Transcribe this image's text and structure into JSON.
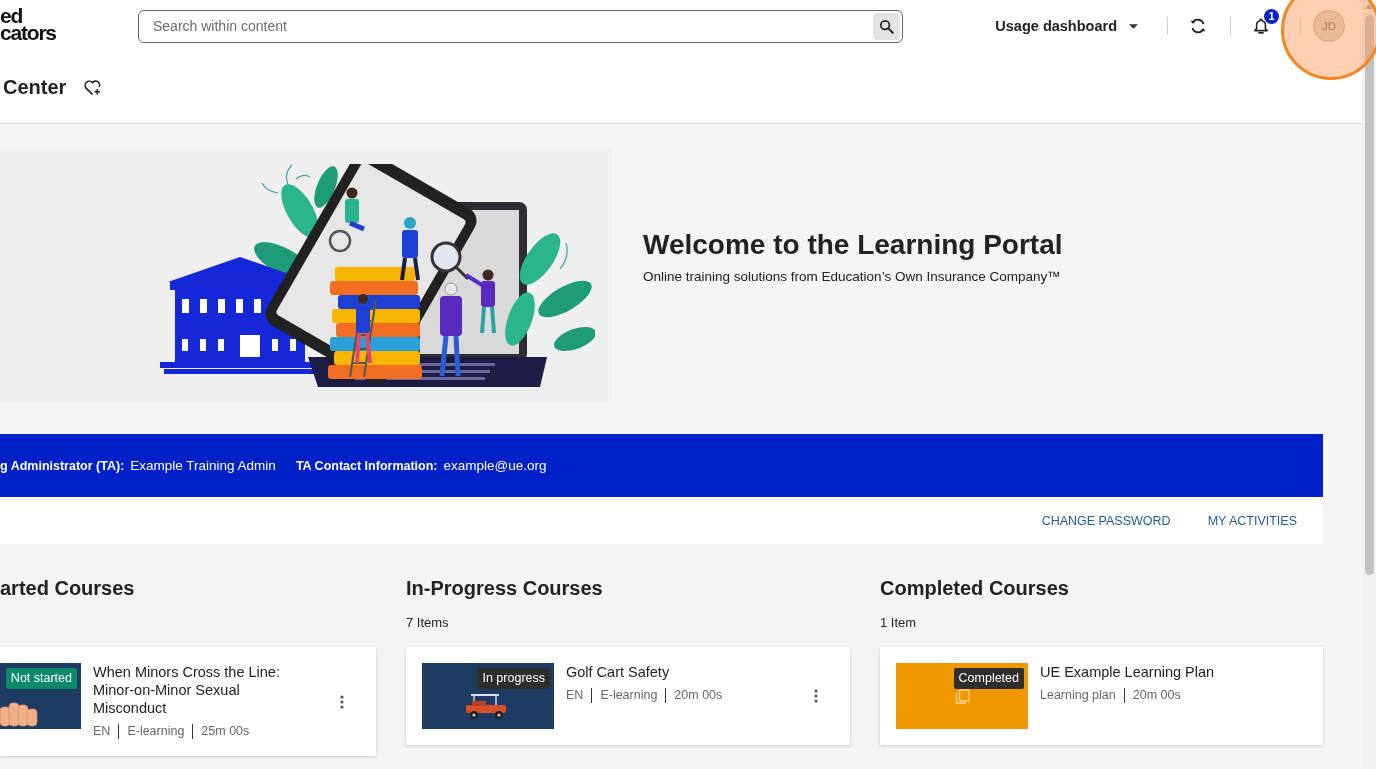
{
  "header": {
    "logo": [
      "ed",
      "cators"
    ],
    "search": {
      "placeholder": "Search within content"
    },
    "menu": {
      "label": "Usage dashboard"
    },
    "notifications": {
      "count": "1"
    },
    "avatar": {
      "initials": "JD"
    }
  },
  "page_title": "Center",
  "banner": {
    "title": "Welcome to the Learning Portal",
    "subtitle": "Online training solutions from Education’s Own Insurance Company™"
  },
  "contact_bar": [
    {
      "label": "g Administrator (TA):",
      "value": "Example Training Admin"
    },
    {
      "label": "TA Contact Information:",
      "value": "example@ue.org"
    }
  ],
  "links": [
    "CHANGE PASSWORD",
    "MY ACTIVITIES"
  ],
  "sections": [
    {
      "kind": "not_started",
      "title": "arted Courses",
      "courses": [
        {
          "kind": "elearning",
          "status": "Not started",
          "title": "When Minors Cross the Line: Minor-on-Minor Sexual Misconduct",
          "meta": [
            "EN",
            "E-learning",
            "25m 00s"
          ],
          "menu": true
        }
      ]
    },
    {
      "kind": "in_progress",
      "title": "In-Progress Courses",
      "count": "7 Items",
      "courses": [
        {
          "kind": "elearning",
          "status": "In progress",
          "title": "Golf Cart Safety",
          "meta": [
            "EN",
            "E-learning",
            "20m 00s"
          ],
          "menu": true
        }
      ]
    },
    {
      "kind": "completed",
      "title": "Completed Courses",
      "count": "1 Item",
      "courses": [
        {
          "kind": "learning_plan",
          "status": "Completed",
          "title": "UE Example Learning Plan",
          "meta": [
            "Learning plan",
            "20m 00s"
          ],
          "menu": false
        }
      ]
    }
  ]
}
